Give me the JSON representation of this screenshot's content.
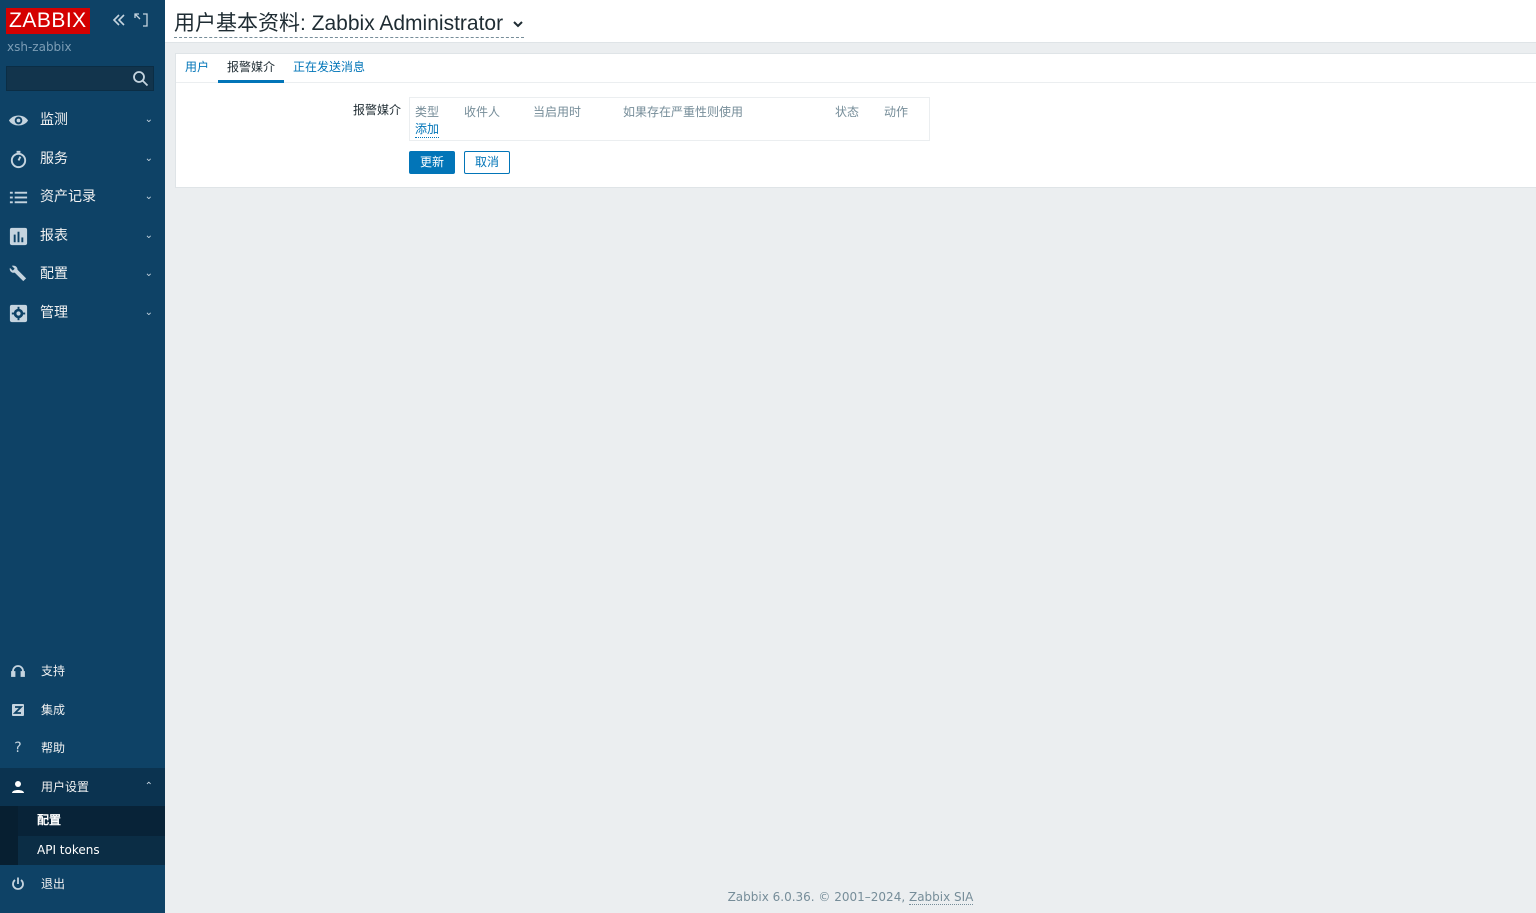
{
  "sidebar": {
    "logo": "ZABBIX",
    "server_name": "xsh-zabbix",
    "search_placeholder": "",
    "menu": [
      {
        "label": "监测",
        "icon": "eye-icon"
      },
      {
        "label": "服务",
        "icon": "stopwatch-icon"
      },
      {
        "label": "资产记录",
        "icon": "list-icon"
      },
      {
        "label": "报表",
        "icon": "bar-chart-icon"
      },
      {
        "label": "配置",
        "icon": "wrench-icon"
      },
      {
        "label": "管理",
        "icon": "gear-icon"
      }
    ],
    "bottom_menu": {
      "support": "支持",
      "integrations": "集成",
      "help": "帮助",
      "user_settings": "用户设置",
      "user_settings_sub": [
        "配置",
        "API tokens"
      ],
      "signout": "退出"
    }
  },
  "header": {
    "title": "用户基本资料: Zabbix Administrator"
  },
  "tabs": [
    "用户",
    "报警媒介",
    "正在发送消息"
  ],
  "active_tab": "报警媒介",
  "form": {
    "media_label": "报警媒介",
    "table_headers": [
      "类型",
      "收件人",
      "当启用时",
      "如果存在严重性则使用",
      "状态",
      "动作"
    ],
    "add_link": "添加",
    "update_button": "更新",
    "cancel_button": "取消"
  },
  "footer": {
    "text": "Zabbix 6.0.36. © 2001–2024, ",
    "company": "Zabbix SIA"
  },
  "colors": {
    "sidebar_bg": "#0e4266",
    "logo_red": "#d40000",
    "accent_blue": "#0275b8",
    "page_bg": "#ebeef0"
  }
}
